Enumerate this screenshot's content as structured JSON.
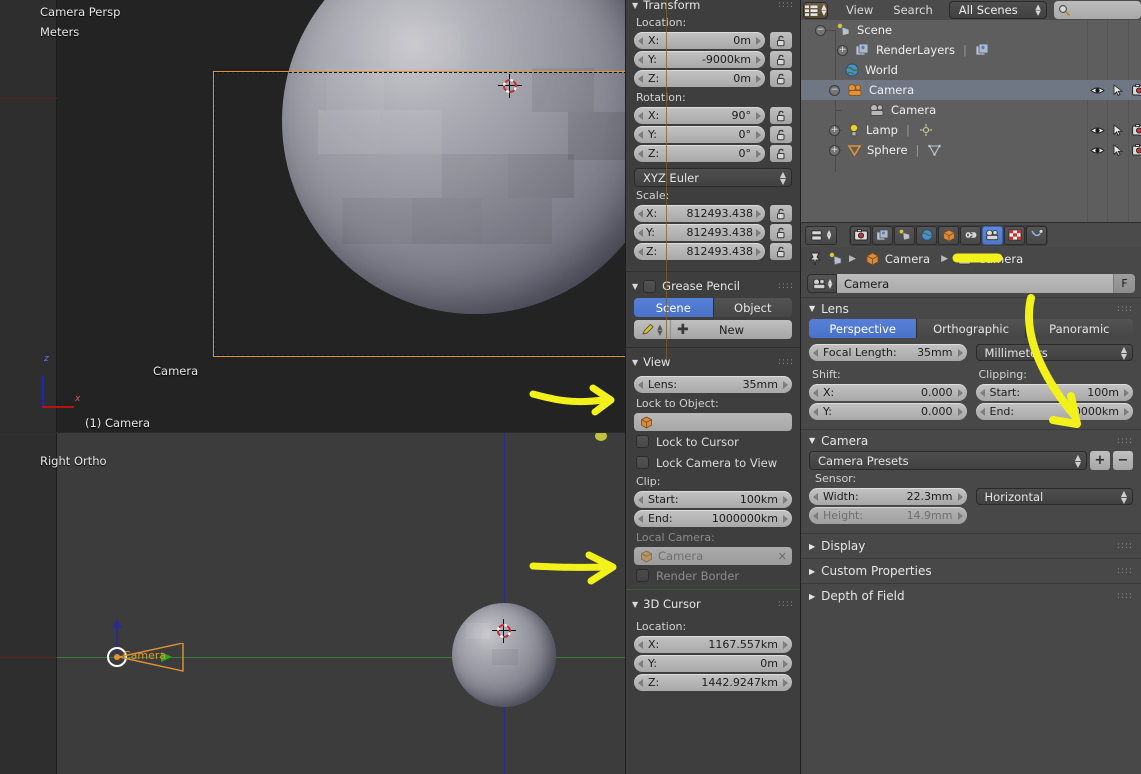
{
  "viewport_top": {
    "view_name": "Camera Persp",
    "unit": "Meters",
    "camera_frame_label": "Camera",
    "active_object": "(1) Camera",
    "axis_z": "z",
    "axis_x": "x"
  },
  "viewport_bottom": {
    "view_name": "Right Ortho",
    "camera_label": "Camera"
  },
  "npanel": {
    "transform": {
      "title": "Transform",
      "location_label": "Location:",
      "location": [
        {
          "axis": "X:",
          "value": "0m"
        },
        {
          "axis": "Y:",
          "value": "-9000km"
        },
        {
          "axis": "Z:",
          "value": "0m"
        }
      ],
      "rotation_label": "Rotation:",
      "rotation": [
        {
          "axis": "X:",
          "value": "90°"
        },
        {
          "axis": "Y:",
          "value": "0°"
        },
        {
          "axis": "Z:",
          "value": "0°"
        }
      ],
      "rotation_mode": "XYZ Euler",
      "scale_label": "Scale:",
      "scale": [
        {
          "axis": "X:",
          "value": "812493.438"
        },
        {
          "axis": "Y:",
          "value": "812493.438"
        },
        {
          "axis": "Z:",
          "value": "812493.438"
        }
      ]
    },
    "grease_pencil": {
      "title": "Grease Pencil",
      "toggle_scene": "Scene",
      "toggle_object": "Object",
      "new_button": "New"
    },
    "view": {
      "title": "View",
      "lens_label": "Lens:",
      "lens_value": "35mm",
      "lock_to_object_label": "Lock to Object:",
      "lock_to_object_value": "",
      "lock_to_cursor": "Lock to Cursor",
      "lock_camera_to_view": "Lock Camera to View",
      "clip_label": "Clip:",
      "clip_start_label": "Start:",
      "clip_start_value": "100km",
      "clip_end_label": "End:",
      "clip_end_value": "1000000km",
      "local_camera_label": "Local Camera:",
      "local_camera_value": "Camera",
      "render_border": "Render Border"
    },
    "cursor3d": {
      "title": "3D Cursor",
      "location_label": "Location:",
      "location": [
        {
          "axis": "X:",
          "value": "1167.557km"
        },
        {
          "axis": "Y:",
          "value": "0m"
        },
        {
          "axis": "Z:",
          "value": "1442.9247km"
        }
      ]
    }
  },
  "outliner": {
    "menu_view": "View",
    "menu_search": "Search",
    "display_mode": "All Scenes",
    "search_value": "",
    "rows": [
      {
        "label": "Scene",
        "indent": 0,
        "icon": "scene-icon",
        "expander": "⊖",
        "selected": false,
        "cols": false
      },
      {
        "label": "RenderLayers",
        "indent": 1,
        "icon": "renderlayers-icon",
        "expander": "⊕",
        "selected": false,
        "cols": false
      },
      {
        "label": "World",
        "indent": 1,
        "icon": "world-icon",
        "expander": "",
        "selected": false,
        "cols": false
      },
      {
        "label": "Camera",
        "indent": 1,
        "icon": "camera-object-icon",
        "expander": "⊖",
        "selected": true,
        "cols": true
      },
      {
        "label": "Camera",
        "indent": 2,
        "icon": "camera-data-icon",
        "expander": "",
        "selected": false,
        "cols": false
      },
      {
        "label": "Lamp",
        "indent": 1,
        "icon": "lamp-icon",
        "expander": "⊕",
        "selected": false,
        "cols": true
      },
      {
        "label": "Sphere",
        "indent": 1,
        "icon": "mesh-icon",
        "expander": "⊕",
        "selected": false,
        "cols": true
      }
    ]
  },
  "properties": {
    "breadcrumb_object": "Camera",
    "breadcrumb_data": "Camera",
    "datablock_name": "Camera",
    "fake_user_button": "F",
    "lens": {
      "title": "Lens",
      "type_perspective": "Perspective",
      "type_orthographic": "Orthographic",
      "type_panoramic": "Panoramic",
      "focal_length_label": "Focal Length:",
      "focal_length_value": "35mm",
      "focal_unit": "Millimeters",
      "shift_label": "Shift:",
      "shift_x_label": "X:",
      "shift_x_value": "0.000",
      "shift_y_label": "Y:",
      "shift_y_value": "0.000",
      "clipping_label": "Clipping:",
      "clip_start_label": "Start:",
      "clip_start_value": "100m",
      "clip_end_label": "End:",
      "clip_end_value": "10000km"
    },
    "camera": {
      "title": "Camera",
      "presets": "Camera Presets",
      "add_preset": "+",
      "remove_preset": "−",
      "sensor_label": "Sensor:",
      "width_label": "Width:",
      "width_value": "22.3mm",
      "height_label": "Height:",
      "height_value": "14.9mm",
      "fit": "Horizontal"
    },
    "collapsed_panels": [
      {
        "title": "Display"
      },
      {
        "title": "Custom Properties"
      },
      {
        "title": "Depth of Field"
      }
    ]
  },
  "colors": {
    "accent_blue": "#5680d8",
    "annotation_yellow": "#f2f21a",
    "camera_orange": "#e09434",
    "grid_green": "#3a7a3a",
    "grid_blue": "#2b2b8a"
  }
}
